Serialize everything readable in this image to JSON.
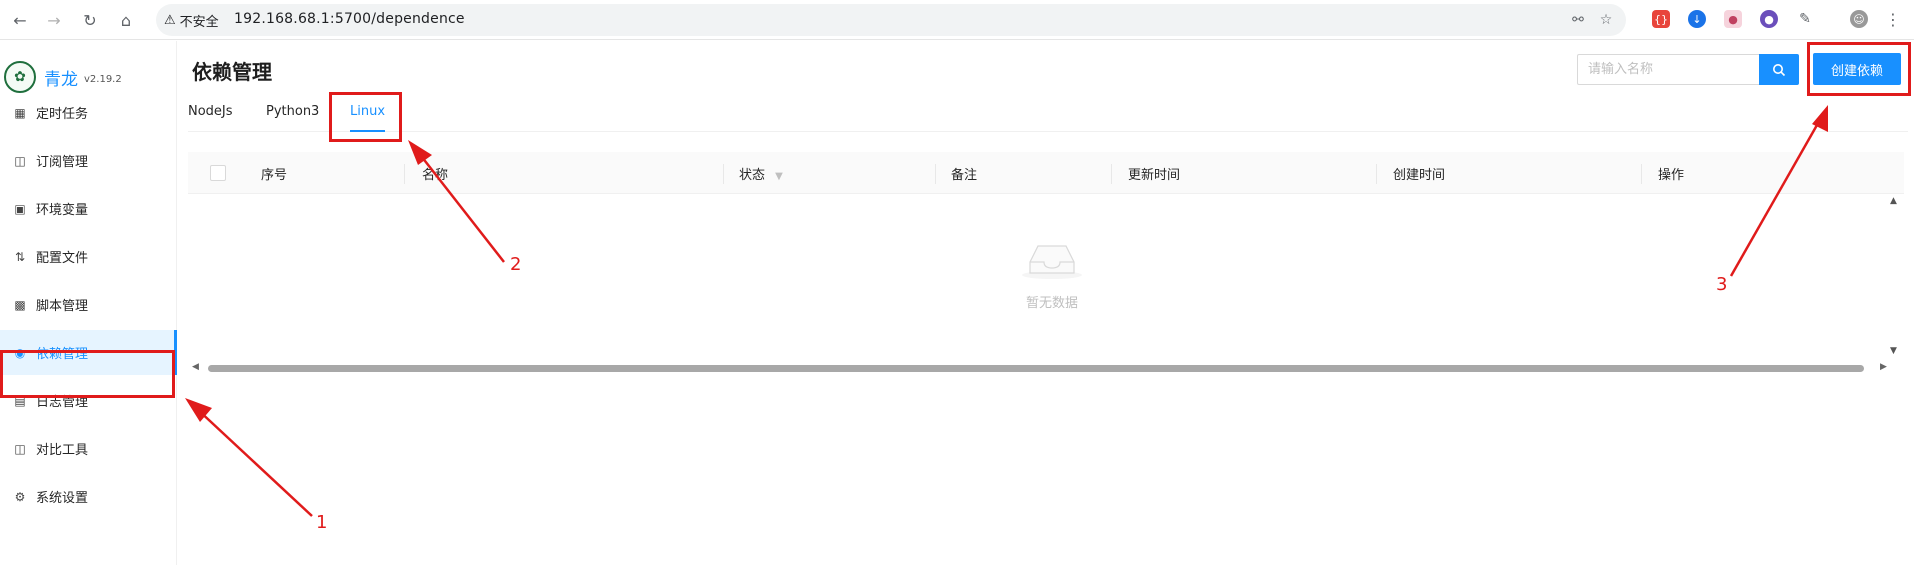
{
  "browser": {
    "insecure_label": "不安全",
    "url": "192.168.68.1:5700/dependence"
  },
  "sidebar": {
    "brand_name": "青龙",
    "version": "v2.19.2",
    "items": [
      {
        "label": "定时任务",
        "icon": "calendar-icon"
      },
      {
        "label": "订阅管理",
        "icon": "subscribe-icon"
      },
      {
        "label": "环境变量",
        "icon": "monitor-icon"
      },
      {
        "label": "配置文件",
        "icon": "sliders-icon"
      },
      {
        "label": "脚本管理",
        "icon": "code-icon"
      },
      {
        "label": "依赖管理",
        "icon": "package-icon",
        "active": true
      },
      {
        "label": "日志管理",
        "icon": "log-icon"
      },
      {
        "label": "对比工具",
        "icon": "diff-icon"
      },
      {
        "label": "系统设置",
        "icon": "gear-icon"
      }
    ]
  },
  "page": {
    "title": "依赖管理",
    "search_placeholder": "请输入名称",
    "create_button": "创建依赖"
  },
  "tabs": [
    {
      "label": "NodeJs"
    },
    {
      "label": "Python3"
    },
    {
      "label": "Linux",
      "active": true
    }
  ],
  "table": {
    "columns": [
      "序号",
      "名称",
      "状态",
      "备注",
      "更新时间",
      "创建时间",
      "操作"
    ],
    "empty_text": "暂无数据"
  },
  "annotations": [
    "1",
    "2",
    "3"
  ],
  "colors": {
    "accent": "#1890ff",
    "annotation": "#e01b1b"
  }
}
